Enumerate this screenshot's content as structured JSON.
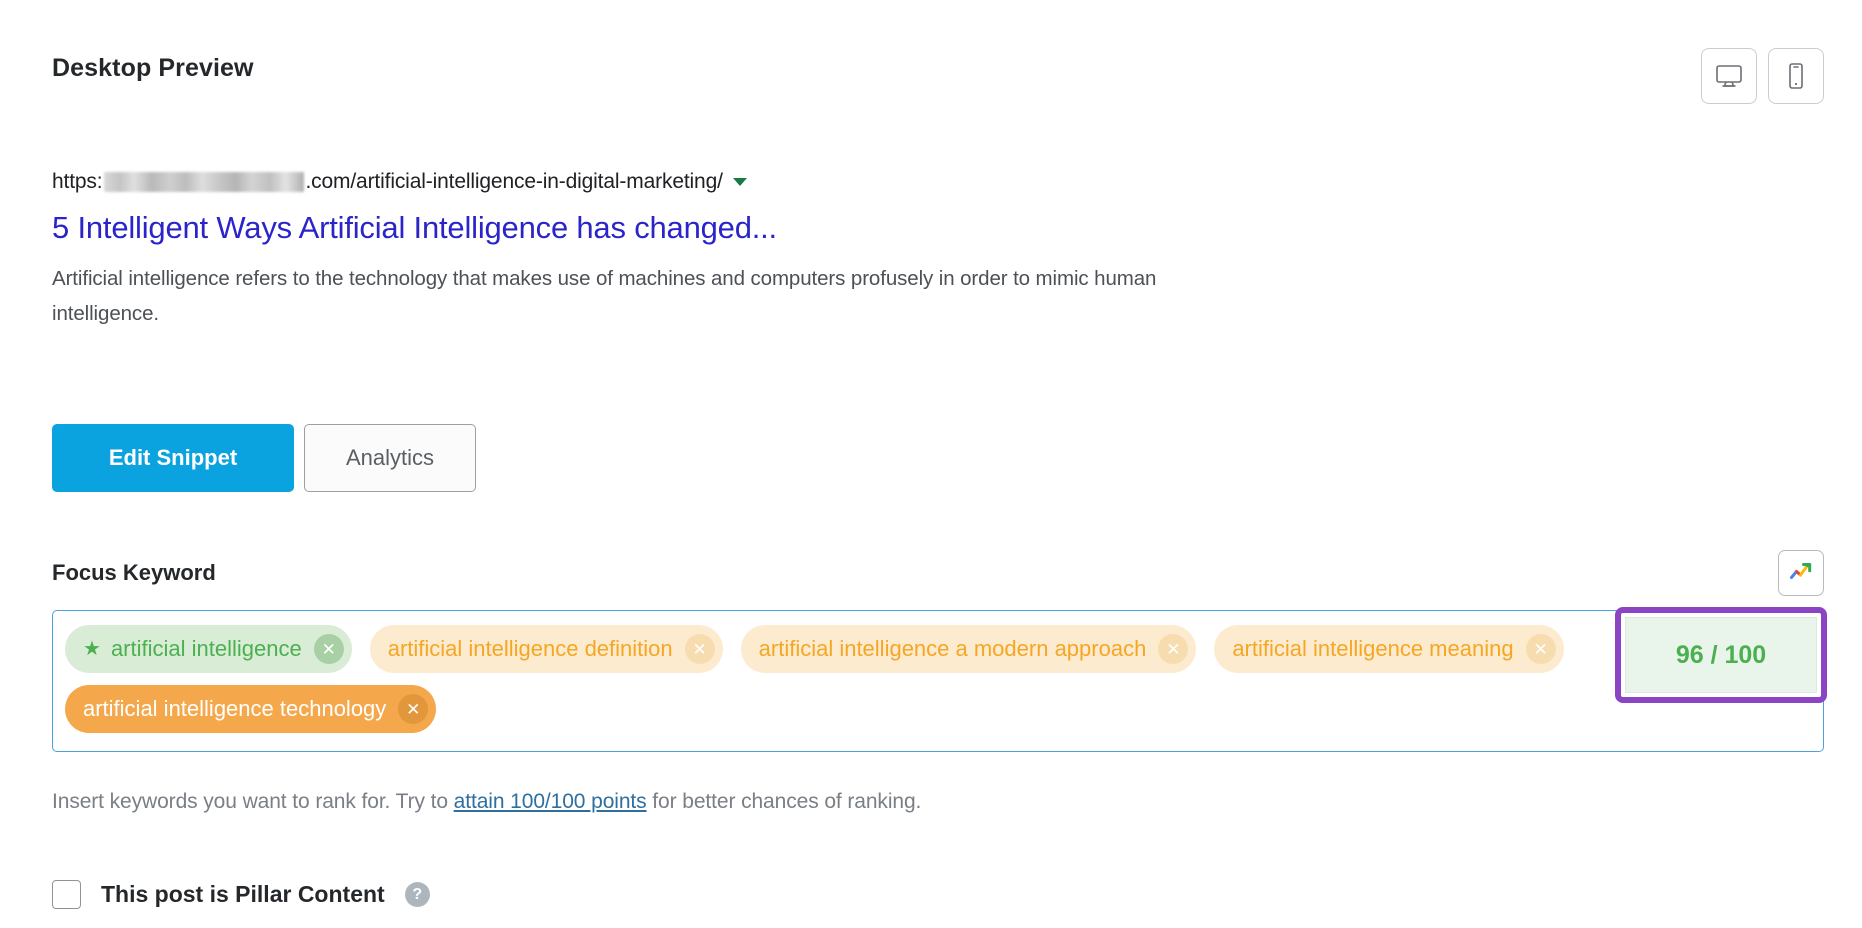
{
  "header": {
    "title": "Desktop Preview",
    "devices": [
      {
        "name": "desktop-view-button",
        "icon": "monitor-icon"
      },
      {
        "name": "mobile-view-button",
        "icon": "phone-icon"
      }
    ]
  },
  "snippet": {
    "url_prefix": "https:",
    "url_domain_redacted": "",
    "url_suffix": ".com/artificial-intelligence-in-digital-marketing/",
    "title": "5 Intelligent Ways Artificial Intelligence has changed...",
    "description": "Artificial intelligence refers to the technology that makes use of machines and computers profusely in order to mimic human intelligence."
  },
  "actions": {
    "edit_snippet_label": "Edit Snippet",
    "analytics_label": "Analytics"
  },
  "focus_keyword": {
    "label": "Focus Keyword",
    "trends_icon": "google-trends-icon",
    "score": "96 / 100",
    "score_highlight_color": "#8b44c4",
    "score_text_color": "#4caf50",
    "keywords": [
      {
        "text": "artificial intelligence",
        "style": "green",
        "primary": true,
        "star": "★",
        "remove": "✕"
      },
      {
        "text": "artificial intelligence definition",
        "style": "orange",
        "primary": false,
        "remove": "✕"
      },
      {
        "text": "artificial intelligence a modern approach",
        "style": "orange",
        "primary": false,
        "remove": "✕"
      },
      {
        "text": "artificial intelligence meaning",
        "style": "orange",
        "primary": false,
        "remove": "✕"
      },
      {
        "text": "artificial intelligence technology",
        "style": "orange-solid",
        "primary": false,
        "remove": "✕"
      }
    ],
    "helper_before": "Insert keywords you want to rank for. Try to ",
    "helper_link": "attain 100/100 points",
    "helper_after": " for better chances of ranking."
  },
  "pillar": {
    "label": "This post is Pillar Content",
    "checked": false,
    "help": "?"
  }
}
